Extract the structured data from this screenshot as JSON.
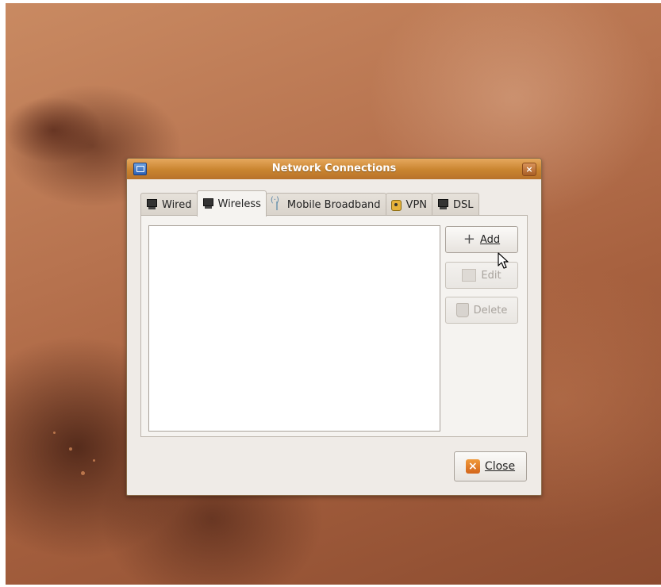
{
  "window": {
    "title": "Network Connections"
  },
  "tabs": [
    {
      "label": "Wired",
      "icon": "network-wired-icon"
    },
    {
      "label": "Wireless",
      "icon": "network-wireless-icon",
      "active": true
    },
    {
      "label": "Mobile Broadband",
      "icon": "antenna-icon"
    },
    {
      "label": "VPN",
      "icon": "vpn-lock-icon"
    },
    {
      "label": "DSL",
      "icon": "network-dsl-icon"
    }
  ],
  "buttons": {
    "add": {
      "label": "Add",
      "mnemonic": "A"
    },
    "edit": {
      "label": "Edit",
      "mnemonic": "E",
      "disabled": true
    },
    "delete": {
      "label": "Delete",
      "mnemonic": "D",
      "disabled": true
    },
    "close": {
      "label": "Close",
      "mnemonic": "C"
    }
  },
  "colors": {
    "titlebar": "#c9842f",
    "desktop": "#b7734f",
    "close_icon": "#e07a25"
  }
}
